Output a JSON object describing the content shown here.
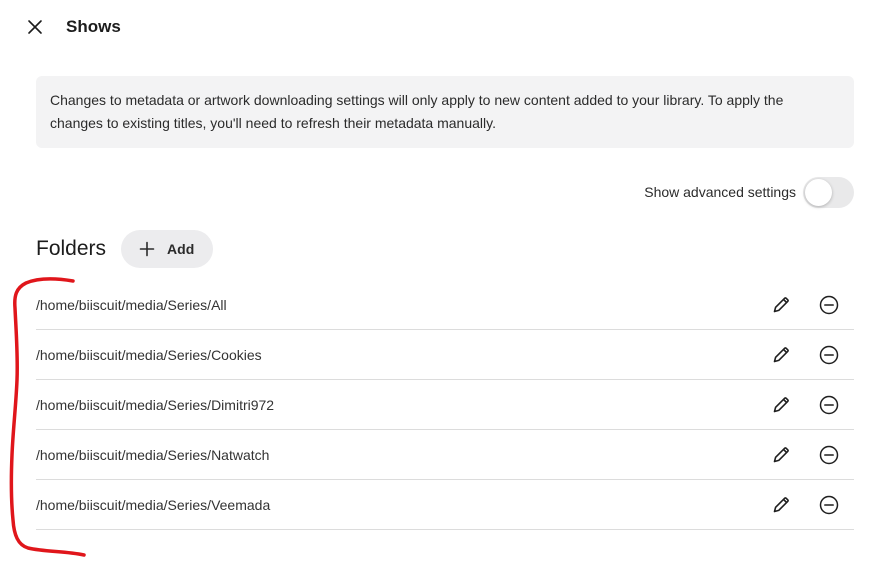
{
  "header": {
    "title": "Shows",
    "close_icon": "close-icon"
  },
  "notice": {
    "text": "Changes to metadata or artwork downloading settings will only apply to new content added to your library. To apply the changes to existing titles, you'll need to refresh their metadata manually."
  },
  "advanced_settings": {
    "label": "Show advanced settings",
    "enabled": false
  },
  "folders": {
    "title": "Folders",
    "add_label": "Add",
    "items": [
      {
        "path": "/home/biiscuit/media/Series/All"
      },
      {
        "path": "/home/biiscuit/media/Series/Cookies"
      },
      {
        "path": "/home/biiscuit/media/Series/Dimitri972"
      },
      {
        "path": "/home/biiscuit/media/Series/Natwatch"
      },
      {
        "path": "/home/biiscuit/media/Series/Veemada"
      }
    ]
  },
  "colors": {
    "annotation": "#e0161b",
    "notice_bg": "#f3f3f4",
    "toggle_off": "#e9e9ea",
    "divider": "#dcdcdc"
  },
  "icons": {
    "edit": "pencil-icon",
    "remove": "minus-circle-icon",
    "add": "plus-icon"
  }
}
